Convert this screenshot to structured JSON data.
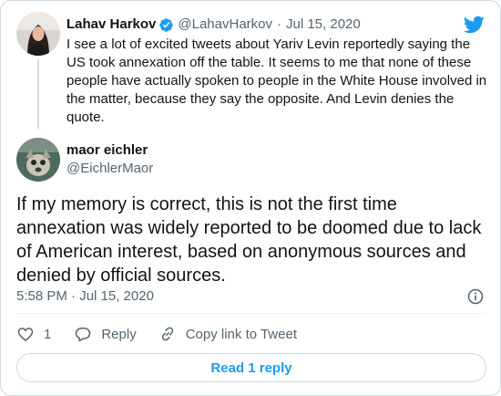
{
  "accent_color": "#1d9bf0",
  "parent_tweet": {
    "author_name": "Lahav Harkov",
    "author_handle": "@LahavHarkov",
    "separator": "·",
    "date": "Jul 15, 2020",
    "verified_icon": "verified-badge-icon",
    "text": "I see a lot of excited tweets about Yariv Levin reportedly saying the US took annexation off the table. It seems to me that none of these people have actually spoken to people in the White House involved in the matter, because they say the opposite. And Levin denies the quote."
  },
  "main_tweet": {
    "author_name": "maor eichler",
    "author_handle": "@EichlerMaor",
    "text": "If my memory is correct, this is not the first time annexation was widely reported to be doomed due to lack of American interest, based on anonymous sources and denied by official sources.",
    "timestamp": "5:58 PM · Jul 15, 2020"
  },
  "actions": {
    "like_count": "1",
    "reply_label": "Reply",
    "copy_link_label": "Copy link to Tweet"
  },
  "read_reply_label": "Read 1 reply",
  "icons": [
    "twitter-bird-icon",
    "verified-badge-icon",
    "info-icon",
    "heart-icon",
    "reply-icon",
    "link-icon"
  ]
}
